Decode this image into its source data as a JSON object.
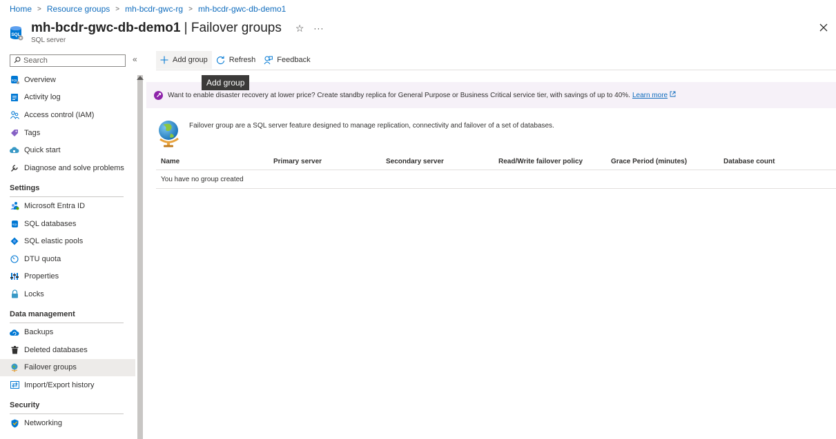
{
  "breadcrumb": [
    "Home",
    "Resource groups",
    "mh-bcdr-gwc-rg",
    "mh-bcdr-gwc-db-demo1"
  ],
  "header": {
    "resource_name": "mh-bcdr-gwc-db-demo1",
    "page_name": "| Failover groups",
    "subtitle": "SQL server",
    "more": "···",
    "icon_label": "SQL"
  },
  "sidebar": {
    "search_placeholder": "Search",
    "collapse": "«",
    "top_items": [
      {
        "label": "Overview",
        "icon": "sql-server-icon"
      },
      {
        "label": "Activity log",
        "icon": "activity-log-icon"
      },
      {
        "label": "Access control (IAM)",
        "icon": "people-icon"
      },
      {
        "label": "Tags",
        "icon": "tag-icon"
      },
      {
        "label": "Quick start",
        "icon": "cloud-icon"
      },
      {
        "label": "Diagnose and solve problems",
        "icon": "wrench-icon"
      }
    ],
    "sections": [
      {
        "title": "Settings",
        "items": [
          {
            "label": "Microsoft Entra ID",
            "icon": "entra-icon"
          },
          {
            "label": "SQL databases",
            "icon": "sql-db-icon"
          },
          {
            "label": "SQL elastic pools",
            "icon": "elastic-pool-icon"
          },
          {
            "label": "DTU quota",
            "icon": "gauge-icon"
          },
          {
            "label": "Properties",
            "icon": "properties-icon"
          },
          {
            "label": "Locks",
            "icon": "lock-icon"
          }
        ]
      },
      {
        "title": "Data management",
        "items": [
          {
            "label": "Backups",
            "icon": "backup-cloud-icon"
          },
          {
            "label": "Deleted databases",
            "icon": "trash-icon"
          },
          {
            "label": "Failover groups",
            "icon": "globe-icon",
            "active": true
          },
          {
            "label": "Import/Export history",
            "icon": "import-export-icon"
          }
        ]
      },
      {
        "title": "Security",
        "items": [
          {
            "label": "Networking",
            "icon": "shield-icon"
          }
        ]
      }
    ]
  },
  "toolbar": {
    "add_group": "Add group",
    "refresh": "Refresh",
    "feedback": "Feedback"
  },
  "tooltip": "Add group",
  "banner": {
    "text": "Want to enable disaster recovery at lower price? Create standby replica for General Purpose or Business Critical service tier, with savings of up to 40%.",
    "link": "Learn more"
  },
  "intro": "Failover group are a SQL server feature designed to manage replication, connectivity and failover of a set of databases.",
  "table": {
    "columns": [
      "Name",
      "Primary server",
      "Secondary server",
      "Read/Write failover policy",
      "Grace Period (minutes)",
      "Database count"
    ],
    "empty": "You have no group created"
  },
  "colors": {
    "accent": "#0f6cbd",
    "banner_bg": "#f6f1f8",
    "rocket": "#8e24aa",
    "active_nav": "#edebe9"
  }
}
